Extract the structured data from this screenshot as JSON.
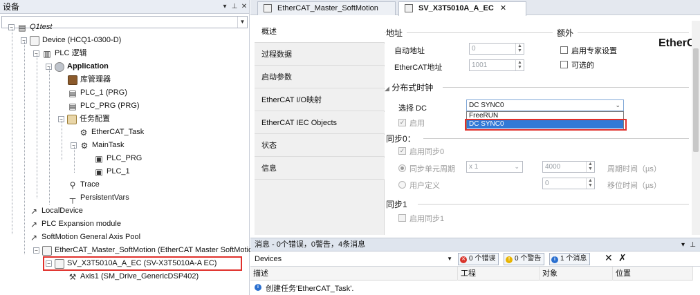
{
  "left_panel": {
    "title": "设备",
    "pin_glyph": "▾  ⊥  ✕",
    "tree": [
      {
        "label": "Q1test",
        "icon": "project-icon"
      },
      {
        "label": "Device (HCQ1-0300-D)",
        "icon": "device-icon"
      },
      {
        "label": "PLC 逻辑",
        "icon": "plc-logic-icon"
      },
      {
        "label": "Application",
        "icon": "application-icon"
      },
      {
        "label": "库管理器",
        "icon": "library-icon"
      },
      {
        "label": "PLC_1 (PRG)",
        "icon": "program-icon"
      },
      {
        "label": "PLC_PRG (PRG)",
        "icon": "program-icon"
      },
      {
        "label": "任务配置",
        "icon": "task-config-icon"
      },
      {
        "label": "EtherCAT_Task",
        "icon": "task-icon"
      },
      {
        "label": "MainTask",
        "icon": "task-icon"
      },
      {
        "label": "PLC_PRG",
        "icon": "program-call-icon"
      },
      {
        "label": "PLC_1",
        "icon": "program-call-icon"
      },
      {
        "label": "Trace",
        "icon": "trace-icon"
      },
      {
        "label": "PersistentVars",
        "icon": "persistent-icon"
      },
      {
        "label": "LocalDevice",
        "icon": "local-device-icon"
      },
      {
        "label": "PLC Expansion module",
        "icon": "module-icon"
      },
      {
        "label": "SoftMotion General Axis Pool",
        "icon": "axis-pool-icon"
      },
      {
        "label": "EtherCAT_Master_SoftMotion (EtherCAT Master SoftMotion)",
        "icon": "ethercat-master-icon"
      },
      {
        "label": "SV_X3T5010A_A_EC (SV-X3T5010A-A EC)",
        "icon": "drive-icon"
      },
      {
        "label": "Axis1 (SM_Drive_GenericDSP402)",
        "icon": "axis-icon"
      }
    ]
  },
  "tabs": [
    {
      "label": "EtherCAT_Master_SoftMotion"
    },
    {
      "label": "SV_X3T5010A_A_EC",
      "close": "✕"
    }
  ],
  "nav": [
    "概述",
    "过程数据",
    "启动参数",
    "EtherCAT I/O映射",
    "EtherCAT IEC Objects",
    "状态",
    "信息"
  ],
  "content": {
    "address_title": "地址",
    "extra_title": "额外",
    "auto_address_label": "自动地址",
    "auto_address_value": "0",
    "ethercat_address_label": "EtherCAT地址",
    "ethercat_address_value": "1001",
    "expert_label": "启用专家设置",
    "optional_label": "可选的",
    "logo_text": "EtherC",
    "dc_title": "分布式时钟",
    "select_dc_label": "选择 DC",
    "select_dc_value": "DC SYNC0",
    "dc_options": [
      "FreeRUN",
      "DC SYNC0"
    ],
    "enable_label": "启用",
    "sync0_title": "同步0：",
    "enable_sync0_label": "启用同步0",
    "sync_unit_label": "同步单元周期",
    "sync_unit_value": "x 1",
    "cycle_value": "4000",
    "cycle_label": "周期时间（µs）",
    "user_defined_label": "用户定义",
    "shift_value": "0",
    "shift_label": "移位时间（µs）",
    "sync1_title": "同步1",
    "enable_sync1_label": "启用同步1"
  },
  "messages": {
    "header": "消息 - 0个错误，0警告，4条消息",
    "source": "Devices",
    "errors": "0 个错误",
    "warnings": "0 个警告",
    "infos": "1 个消息",
    "columns": [
      "描述",
      "工程",
      "对象",
      "位置"
    ],
    "rows": [
      {
        "text": "创建任务'EtherCAT_Task'."
      }
    ]
  },
  "colors": {
    "highlight_red": "#e0302b",
    "select_blue": "#3179d6"
  }
}
